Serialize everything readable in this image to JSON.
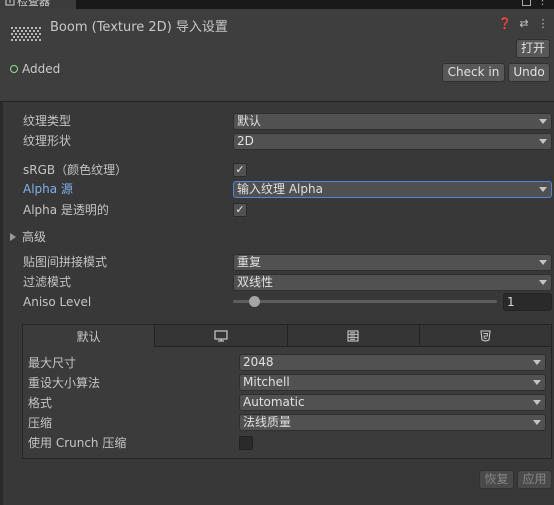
{
  "tab": {
    "title": "检查器"
  },
  "header": {
    "asset_title": "Boom (Texture 2D) 导入设置",
    "open_label": "打开",
    "status": "Added",
    "checkin_label": "Check in",
    "undo_label": "Undo",
    "icons": [
      "help-icon",
      "preset-icon",
      "more-icon"
    ]
  },
  "settings": {
    "texture_type": {
      "label": "纹理类型",
      "value": "默认"
    },
    "texture_shape": {
      "label": "纹理形状",
      "value": "2D"
    },
    "srgb": {
      "label": "sRGB（颜色纹理）",
      "checked": true
    },
    "alpha_source": {
      "label": "Alpha 源",
      "value": "输入纹理 Alpha"
    },
    "alpha_transparency": {
      "label": "Alpha 是透明的",
      "checked": true
    },
    "advanced": {
      "label": "高级"
    },
    "wrap_mode": {
      "label": "贴图间拼接模式",
      "value": "重复"
    },
    "filter_mode": {
      "label": "过滤模式",
      "value": "双线性"
    },
    "aniso": {
      "label": "Aniso Level",
      "value": "1"
    }
  },
  "platform": {
    "tabs": [
      {
        "label": "默认",
        "icon": ""
      },
      {
        "label": "",
        "icon": "monitor-icon"
      },
      {
        "label": "",
        "icon": "server-icon"
      },
      {
        "label": "",
        "icon": "html5-icon"
      }
    ],
    "max_size": {
      "label": "最大尺寸",
      "value": "2048"
    },
    "resize_algorithm": {
      "label": "重设大小算法",
      "value": "Mitchell"
    },
    "format": {
      "label": "格式",
      "value": "Automatic"
    },
    "compression": {
      "label": "压缩",
      "value": "法线质量"
    },
    "crunch": {
      "label": "使用 Crunch 压缩",
      "checked": false
    }
  },
  "footer": {
    "revert_label": "恢复",
    "apply_label": "应用"
  }
}
